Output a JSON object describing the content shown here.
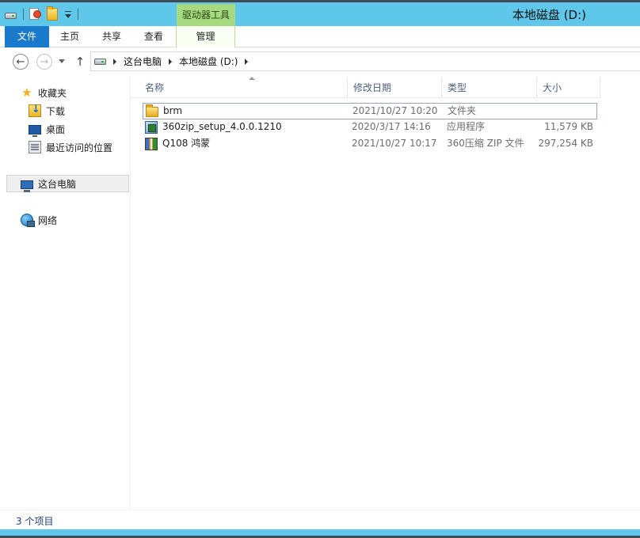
{
  "window": {
    "title": "本地磁盘 (D:)",
    "context_tab": "驱动器工具",
    "accent_color": "#5fc8ea"
  },
  "quick_access_toolbar": {
    "icons": [
      "drive-icon",
      "properties-icon",
      "new-folder-icon",
      "customize-caret-icon"
    ]
  },
  "ribbon": {
    "tabs": [
      {
        "label": "文件"
      },
      {
        "label": "主页"
      },
      {
        "label": "共享"
      },
      {
        "label": "查看"
      },
      {
        "label": "管理"
      }
    ]
  },
  "address": {
    "crumbs": [
      "这台电脑",
      "本地磁盘 (D:)"
    ]
  },
  "navigation": {
    "favorites_label": "收藏夹",
    "favorites": [
      {
        "label": "下载",
        "icon": "download-folder-icon"
      },
      {
        "label": "桌面",
        "icon": "desktop-icon"
      },
      {
        "label": "最近访问的位置",
        "icon": "recent-places-icon"
      }
    ],
    "this_pc": "这台电脑",
    "network": "网络"
  },
  "columns": {
    "name": "名称",
    "date": "修改日期",
    "type": "类型",
    "size": "大小"
  },
  "files": [
    {
      "name": "brm",
      "date": "2021/10/27 10:20",
      "type": "文件夹",
      "size": "",
      "icon": "folder-icon"
    },
    {
      "name": "360zip_setup_4.0.0.1210",
      "date": "2020/3/17 14:16",
      "type": "应用程序",
      "size": "11,579 KB",
      "icon": "installer-icon"
    },
    {
      "name": "Q108 鸿蒙",
      "date": "2021/10/27 10:17",
      "type": "360压缩 ZIP 文件",
      "size": "297,254 KB",
      "icon": "zip-archive-icon"
    }
  ],
  "status": {
    "item_count": "3 个项目"
  }
}
